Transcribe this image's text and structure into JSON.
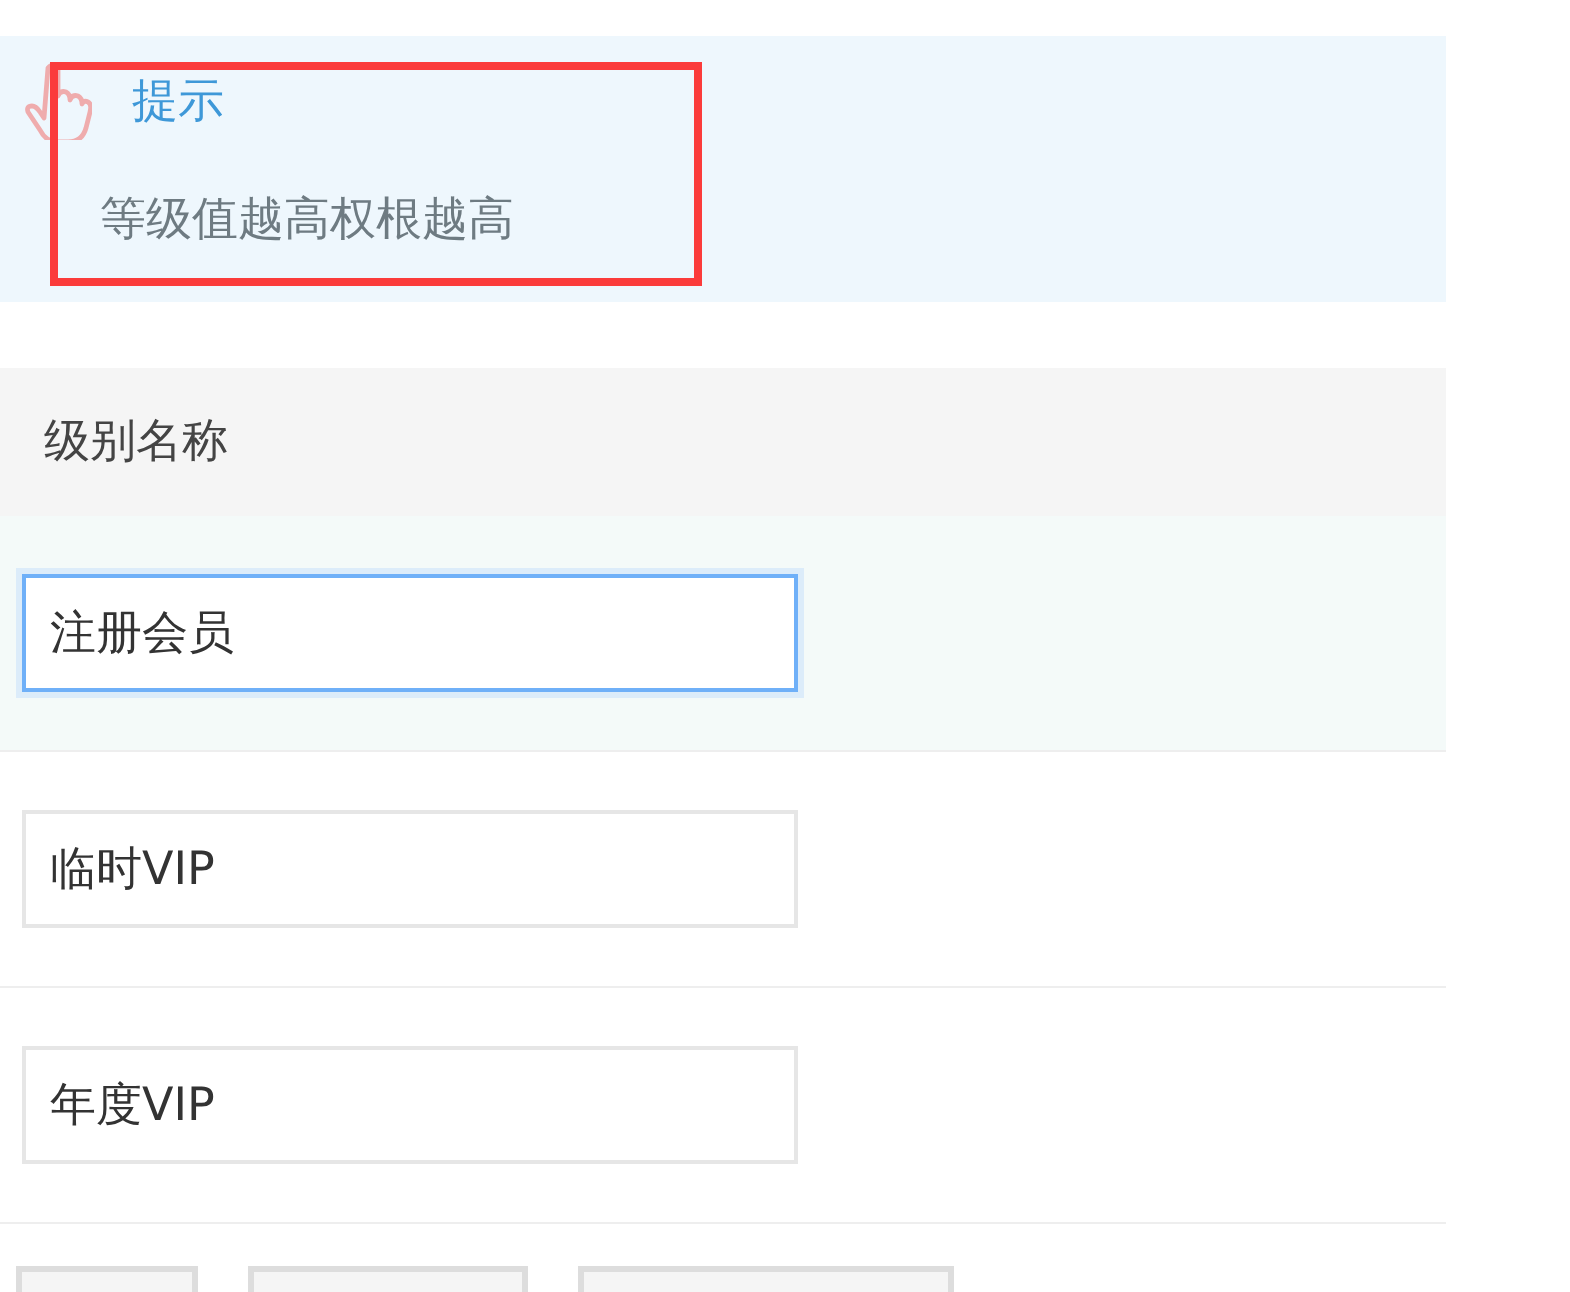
{
  "tip": {
    "title": "提示",
    "text": "等级值越高权根越高",
    "highlighted": true
  },
  "table": {
    "header": "级别名称",
    "rows": [
      {
        "value": "注册会员",
        "focused": true
      },
      {
        "value": "临时VIP",
        "focused": false
      },
      {
        "value": "年度VIP",
        "focused": false
      }
    ]
  },
  "buttons": [
    {
      "kind": "blank"
    },
    {
      "kind": "blank"
    },
    {
      "kind": "blank"
    }
  ]
}
